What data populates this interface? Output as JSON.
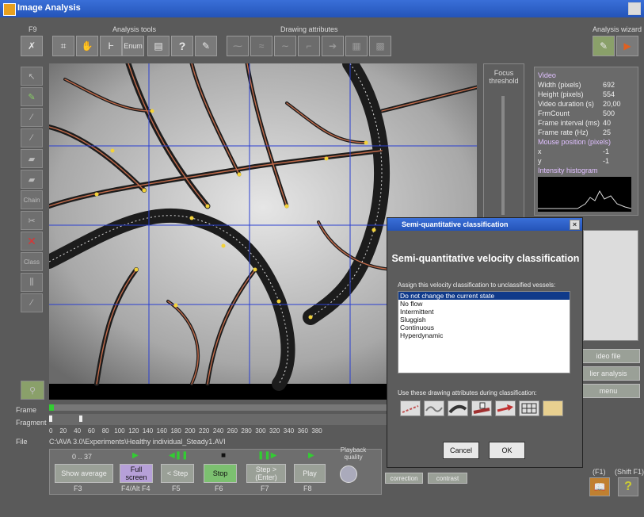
{
  "window": {
    "title": "Image Analysis"
  },
  "sections": {
    "f9": "F9",
    "analysis_tools": "Analysis tools",
    "drawing_attributes": "Drawing attributes",
    "analysis_wizard": "Analysis wizard",
    "focus_threshold": "Focus threshold"
  },
  "toolbar": {
    "enum_label": "Enum",
    "help_label": "?"
  },
  "sidebar": {
    "chain_label": "Chain",
    "class_label": "Class"
  },
  "info": {
    "video_header": "Video",
    "rows": [
      {
        "k": "Width (pixels)",
        "v": "692"
      },
      {
        "k": "Height (pixels)",
        "v": "554"
      },
      {
        "k": "Video duration (s)",
        "v": "20,00"
      },
      {
        "k": "FrmCount",
        "v": "500"
      },
      {
        "k": "Frame interval (ms)",
        "v": "40"
      },
      {
        "k": "Frame rate (Hz)",
        "v": "25"
      }
    ],
    "mouse_header": "Mouse position (pixels)",
    "mouse_rows": [
      {
        "k": "x",
        "v": "-1"
      },
      {
        "k": "y",
        "v": "-1"
      }
    ],
    "histogram_header": "Intensity histogram"
  },
  "right_buttons": {
    "video_file": "ideo file",
    "earlier_analysis": "lier analysis",
    "menu": "menu"
  },
  "timeline": {
    "frame_label": "Frame",
    "fragment_label": "Fragment",
    "file_label": "File",
    "ticks": "0    20    40    60    80   100  120  140  160  180  200  220  240  260  280  300  320  340  360  380",
    "file_path": "C:\\AVA 3.0\\Experiments\\Healthy individual_Steady1.AVI"
  },
  "playback": {
    "range": "0 ..  37",
    "buttons": [
      {
        "label": "Show average",
        "key": "F3"
      },
      {
        "label": "Full screen",
        "key": "F4/Alt F4"
      },
      {
        "label": "< Step",
        "key": "F5"
      },
      {
        "label": "Stop",
        "key": "F6"
      },
      {
        "label": "Step > (Enter)",
        "key": "F7"
      },
      {
        "label": "Play",
        "key": "F8"
      }
    ],
    "quality_label": "Playback quality"
  },
  "bottom_right": {
    "correction": "correction",
    "contrast": "contrast",
    "f1": "(F1)",
    "shift_f1": "(Shift F1)"
  },
  "dialog": {
    "caption": "Semi-quantitative classification",
    "heading": "Semi-quantitative velocity classification",
    "assign_label": "Assign this velocity classification to unclassified vessels:",
    "options": [
      "Do not change the current state",
      "No flow",
      "Intermittent",
      "Sluggish",
      "Continuous",
      "Hyperdynamic"
    ],
    "selected_index": 0,
    "use_label": "Use these drawing attributes during classification:",
    "cancel": "Cancel",
    "ok": "OK"
  },
  "colors": {
    "title_blue": "#2454b8",
    "vessel": "#c06a4a",
    "grid_blue": "#2a3fd0",
    "junction": "#f2d23a"
  }
}
